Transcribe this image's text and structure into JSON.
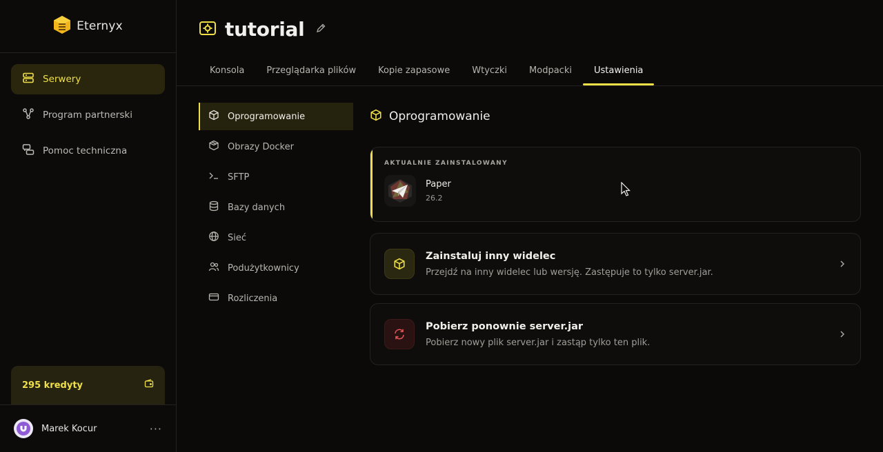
{
  "brand": {
    "name": "Eternyx"
  },
  "sidebar": {
    "items": [
      {
        "label": "Serwery",
        "icon": "server-icon",
        "active": true
      },
      {
        "label": "Program partnerski",
        "icon": "share-icon",
        "active": false
      },
      {
        "label": "Pomoc techniczna",
        "icon": "chat-icon",
        "active": false
      }
    ],
    "credits": "295 kredyty",
    "user_name": "Marek Kocur",
    "more": "···"
  },
  "header": {
    "title": "tutorial",
    "tabs": [
      "Konsola",
      "Przeglądarka plików",
      "Kopie zapasowe",
      "Wtyczki",
      "Modpacki",
      "Ustawienia"
    ],
    "active_tab": "Ustawienia"
  },
  "settings_menu": [
    {
      "label": "Oprogramowanie",
      "icon": "cube-icon",
      "active": true
    },
    {
      "label": "Obrazy Docker",
      "icon": "docker-icon"
    },
    {
      "label": "SFTP",
      "icon": "terminal-icon"
    },
    {
      "label": "Bazy danych",
      "icon": "database-icon"
    },
    {
      "label": "Sieć",
      "icon": "globe-icon"
    },
    {
      "label": "Podużytkownicy",
      "icon": "users-icon"
    },
    {
      "label": "Rozliczenia",
      "icon": "card-icon"
    }
  ],
  "main": {
    "section_title": "Oprogramowanie",
    "installed": {
      "label": "AKTUALNIE ZAINSTALOWANY",
      "name": "Paper",
      "version": "26.2"
    },
    "actions": [
      {
        "title": "Zainstaluj inny widelec",
        "desc": "Przejdź na inny widelec lub wersję. Zastępuje to tylko server.jar.",
        "icon": "cube-icon",
        "color": "#f0e046"
      },
      {
        "title": "Pobierz ponownie server.jar",
        "desc": "Pobierz nowy plik server.jar i zastąp tylko ten plik.",
        "icon": "refresh-icon",
        "color": "#e05454"
      }
    ]
  },
  "colors": {
    "accent": "#f0e046",
    "background": "#0b0a09"
  }
}
